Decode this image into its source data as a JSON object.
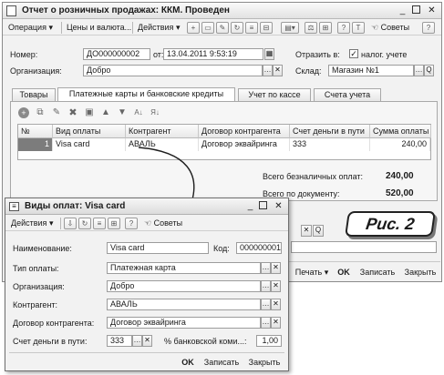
{
  "main": {
    "title": "Отчет о розничных продажах: ККМ. Проведен",
    "menu": {
      "operation": "Операция",
      "prices": "Цены и валюта...",
      "actions": "Действия",
      "advice": "Советы"
    },
    "number_label": "Номер:",
    "number_value": "ДО000000002",
    "from_label": "от:",
    "date_value": "13.04.2011  9:53:19",
    "tax_label": "Отразить в:",
    "tax_checkbox_label": "налог. учете",
    "org_label": "Организация:",
    "org_value": "Добро",
    "warehouse_label": "Склад:",
    "warehouse_value": "Магазин №1",
    "tabs": [
      "Товары",
      "Платежные карты и банковские кредиты",
      "Учет по кассе",
      "Счета учета"
    ],
    "table": {
      "headers": [
        "№",
        "Вид оплаты",
        "Контрагент",
        "Договор контрагента",
        "Счет деньги в пути",
        "Сумма оплаты"
      ],
      "rows": [
        {
          "n": "1",
          "type": "Visa card",
          "contractor": "АВАЛЬ",
          "contract": "Договор эквайринга",
          "account": "333",
          "amount": "240,00"
        }
      ]
    },
    "totals": {
      "cashless_label": "Всего безналичных оплат:",
      "cashless_value": "240,00",
      "doc_label": "Всего по документу:",
      "doc_value": "520,00"
    },
    "bottom": {
      "print": "Печать",
      "ok": "OK",
      "save": "Записать",
      "close": "Закрыть"
    }
  },
  "dialog": {
    "title": "Виды оплат: Visa card",
    "menu": {
      "actions": "Действия",
      "advice": "Советы"
    },
    "name_label": "Наименование:",
    "name_value": "Visa card",
    "code_label": "Код:",
    "code_value": "000000001",
    "paytype_label": "Тип оплаты:",
    "paytype_value": "Платежная карта",
    "org_label": "Организация:",
    "org_value": "Добро",
    "contractor_label": "Контрагент:",
    "contractor_value": "АВАЛЬ",
    "contract_label": "Договор контрагента:",
    "contract_value": "Договор эквайринга",
    "account_label": "Счет деньги в пути:",
    "account_value": "333",
    "commission_label": "% банковской коми...:",
    "commission_value": "1,00",
    "bottom": {
      "ok": "OK",
      "save": "Записать",
      "close": "Закрыть"
    }
  },
  "callout": "Рис. 2"
}
